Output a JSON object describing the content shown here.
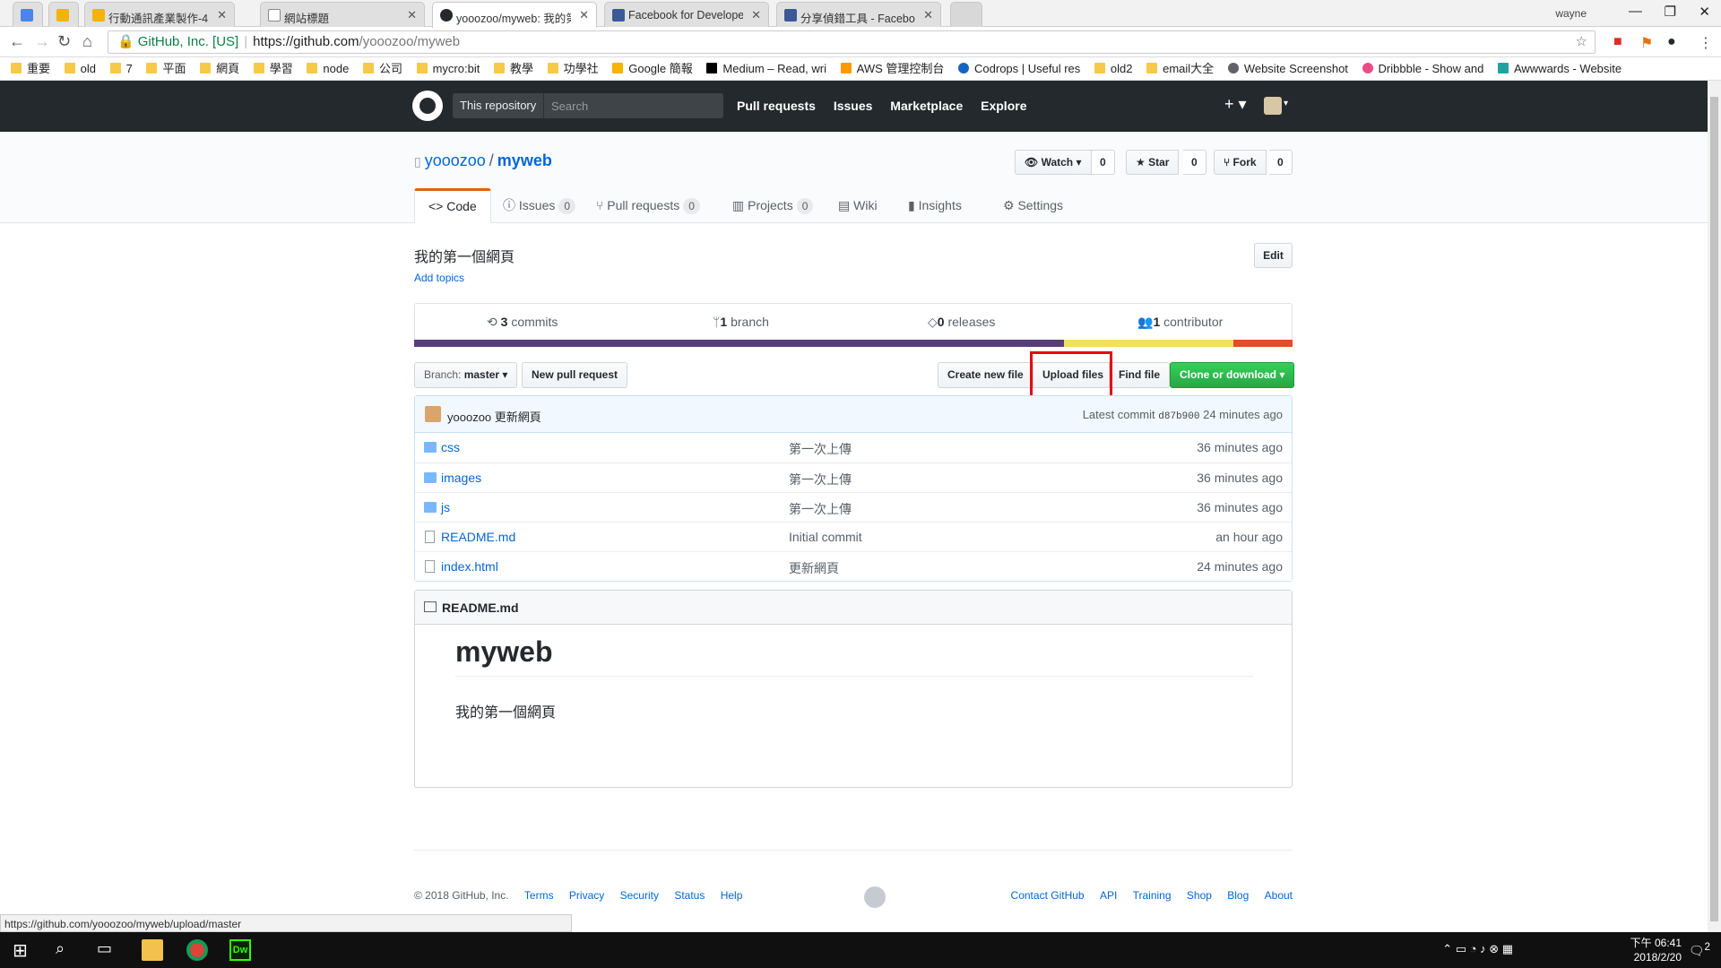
{
  "browser": {
    "tabs": [
      {
        "title": ""
      },
      {
        "title": ""
      },
      {
        "title": "行動通訊產業製作-4 - Go"
      },
      {
        "title": "網站標題"
      },
      {
        "title": "yooozoo/myweb: 我的第"
      },
      {
        "title": "Facebook for Develope"
      },
      {
        "title": "分享偵錯工具 - Faceboo"
      }
    ],
    "profile": "wayne",
    "org_badge": "GitHub, Inc. [US]",
    "url_host": "https://github.com",
    "url_path": "/yooozoo/myweb",
    "bookmarks": [
      "重要",
      "old",
      "7",
      "平面",
      "網頁",
      "學習",
      "node",
      "公司",
      "mycro:bit",
      "教學",
      "功學社",
      "Google 簡報",
      "Medium – Read, wri",
      "AWS 管理控制台",
      "Codrops | Useful res",
      "old2",
      "email大全",
      "Website Screenshot",
      "Dribbble - Show and",
      "Awwwards - Website"
    ],
    "status_url": "https://github.com/yooozoo/myweb/upload/master"
  },
  "gh": {
    "scope_label": "This repository",
    "search_placeholder": "Search",
    "nav": [
      "Pull requests",
      "Issues",
      "Marketplace",
      "Explore"
    ],
    "owner": "yooozoo",
    "repo": "myweb",
    "watch_label": "Watch",
    "watch_count": "0",
    "star_label": "Star",
    "star_count": "0",
    "fork_label": "Fork",
    "fork_count": "0",
    "tabs": {
      "code": "Code",
      "issues": "Issues",
      "issues_count": "0",
      "pulls": "Pull requests",
      "pulls_count": "0",
      "projects": "Projects",
      "projects_count": "0",
      "wiki": "Wiki",
      "insights": "Insights",
      "settings": "Settings"
    },
    "description": "我的第一個網頁",
    "add_topics": "Add topics",
    "edit": "Edit",
    "summary": {
      "commits_num": "3",
      "commits_label": "commits",
      "branch_num": "1",
      "branch_label": "branch",
      "releases_num": "0",
      "releases_label": "releases",
      "contributors_num": "1",
      "contributors_label": "contributor"
    },
    "lang_colors": [
      "#563d7c",
      "#f1e05a",
      "#e34c26"
    ],
    "branch_label": "Branch:",
    "branch_value": "master",
    "new_pr": "New pull request",
    "create_file": "Create new file",
    "upload_files": "Upload files",
    "find_file": "Find file",
    "clone": "Clone or download",
    "latest": {
      "author": "yooozoo",
      "message": "更新網頁",
      "prefix": "Latest commit",
      "sha": "d87b900",
      "age": "24 minutes ago"
    },
    "files": [
      {
        "name": "css",
        "type": "dir",
        "message": "第一次上傳",
        "age": "36 minutes ago"
      },
      {
        "name": "images",
        "type": "dir",
        "message": "第一次上傳",
        "age": "36 minutes ago"
      },
      {
        "name": "js",
        "type": "dir",
        "message": "第一次上傳",
        "age": "36 minutes ago"
      },
      {
        "name": "README.md",
        "type": "file",
        "message": "Initial commit",
        "age": "an hour ago"
      },
      {
        "name": "index.html",
        "type": "file",
        "message": "更新網頁",
        "age": "24 minutes ago"
      }
    ],
    "readme": {
      "title": "README.md",
      "h1": "myweb",
      "p": "我的第一個網頁"
    },
    "footer": {
      "copyright": "© 2018 GitHub, Inc.",
      "left_links": [
        "Terms",
        "Privacy",
        "Security",
        "Status",
        "Help"
      ],
      "right_links": [
        "Contact GitHub",
        "API",
        "Training",
        "Shop",
        "Blog",
        "About"
      ]
    }
  },
  "taskbar": {
    "time": "06:41",
    "ampm": "下午",
    "date": "2018/2/20",
    "notif_count": "2"
  }
}
